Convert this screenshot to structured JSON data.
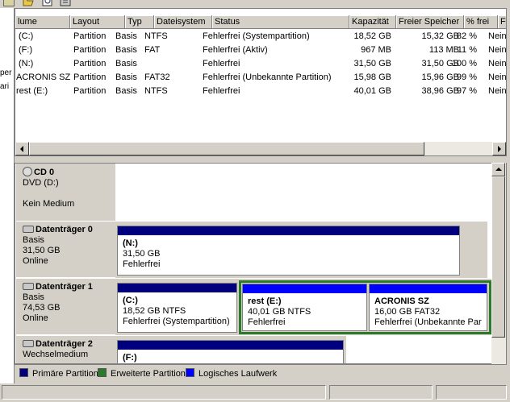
{
  "colors": {
    "primary_partition": "#00007f",
    "extended_partition": "#2a7a2a",
    "logical_drive": "#0000ff"
  },
  "toolbar_icons": [
    "window-icon",
    "open-folder-icon",
    "properties-icon",
    "settings-icon"
  ],
  "tree_fragments": [
    "per",
    "ari"
  ],
  "table": {
    "columns": [
      "lume",
      "Layout",
      "Typ",
      "Dateisystem",
      "Status",
      "Kapazität",
      "Freier Speicher",
      "% frei",
      "Fehl"
    ],
    "rows": [
      [
        "(C:)",
        "Partition",
        "Basis",
        "NTFS",
        "Fehlerfrei (Systempartition)",
        "18,52 GB",
        "15,32 GB",
        "82 %",
        "Nein"
      ],
      [
        "(F:)",
        "Partition",
        "Basis",
        "FAT",
        "Fehlerfrei (Aktiv)",
        "967 MB",
        "113 MB",
        "11 %",
        "Nein"
      ],
      [
        "(N:)",
        "Partition",
        "Basis",
        "",
        "Fehlerfrei",
        "31,50 GB",
        "31,50 GB",
        "100 %",
        "Nein"
      ],
      [
        "ACRONIS SZ",
        "Partition",
        "Basis",
        "FAT32",
        "Fehlerfrei (Unbekannte Partition)",
        "15,98 GB",
        "15,96 GB",
        "99 %",
        "Nein"
      ],
      [
        "rest (E:)",
        "Partition",
        "Basis",
        "NTFS",
        "Fehlerfrei",
        "40,01 GB",
        "38,96 GB",
        "97 %",
        "Nein"
      ]
    ]
  },
  "disks": {
    "cd0": {
      "name": "CD 0",
      "line1": "DVD (D:)",
      "line2": "Kein Medium"
    },
    "disk0": {
      "name": "Datenträger 0",
      "type": "Basis",
      "size": "31,50 GB",
      "state": "Online",
      "partitions": [
        {
          "name": "(N:)",
          "size": "31,50 GB",
          "status": "Fehlerfrei"
        }
      ]
    },
    "disk1": {
      "name": "Datenträger 1",
      "type": "Basis",
      "size": "74,53 GB",
      "state": "Online",
      "partitions": [
        {
          "name": "(C:)",
          "size": "18,52 GB NTFS",
          "status": "Fehlerfrei (Systempartition)"
        },
        {
          "name": "rest  (E:)",
          "size": "40,01 GB NTFS",
          "status": "Fehlerfrei"
        },
        {
          "name": "ACRONIS SZ",
          "size": "16,00 GB FAT32",
          "status": "Fehlerfrei (Unbekannte Par"
        }
      ]
    },
    "disk2": {
      "name": "Datenträger 2",
      "type": "Wechselmedium",
      "partitions": [
        {
          "name": "(F:)"
        }
      ]
    }
  },
  "legend": {
    "primary": "Primäre Partition",
    "extended": "Erweiterte Partition",
    "logical": "Logisches Laufwerk"
  }
}
